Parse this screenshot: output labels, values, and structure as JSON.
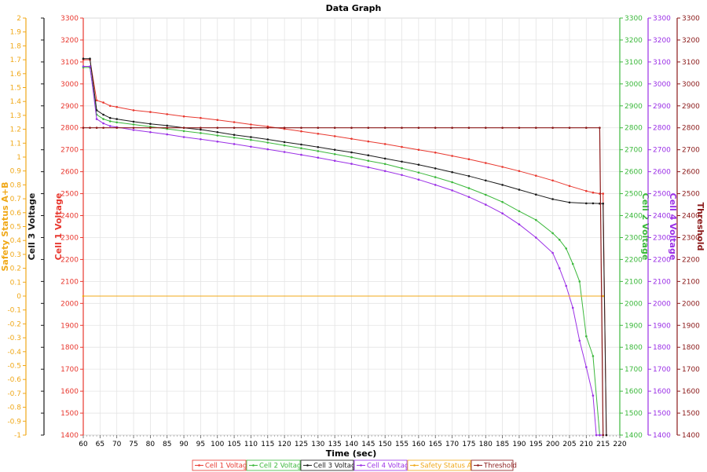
{
  "colors": {
    "cell1": "#e8382f",
    "cell2": "#3cb83c",
    "cell3": "#1a1a1a",
    "cell4": "#9b30e6",
    "safety": "#f0a818",
    "threshold": "#8b1a1a",
    "grid": "#e4e4e4"
  },
  "chart_data": {
    "type": "line",
    "title": "Data Graph",
    "xlabel": "Time (sec)",
    "xlim": [
      60,
      220
    ],
    "xticks": [
      60,
      65,
      70,
      75,
      80,
      85,
      90,
      95,
      100,
      105,
      110,
      115,
      120,
      125,
      130,
      135,
      140,
      145,
      150,
      155,
      160,
      165,
      170,
      175,
      180,
      185,
      190,
      195,
      200,
      205,
      210,
      215,
      220
    ],
    "grid": true,
    "legend_position": "bottom",
    "axes": {
      "cell1": {
        "label": "Cell 1 Voltage",
        "side": "left",
        "ylim": [
          1400,
          3300
        ],
        "ticks": [
          1400,
          1500,
          1600,
          1700,
          1800,
          1900,
          2000,
          2100,
          2200,
          2300,
          2400,
          2500,
          2600,
          2700,
          2800,
          2900,
          3000,
          3100,
          3200,
          3300
        ]
      },
      "cell3": {
        "label": "Cell 3 Voltage",
        "side": "left",
        "ylim": [
          1400,
          3300
        ],
        "ticks": [
          1400,
          1500,
          1600,
          1700,
          1800,
          1900,
          2000,
          2100,
          2200,
          2300,
          2400,
          2500,
          2600,
          2700,
          2800,
          2900,
          3000,
          3100,
          3200,
          3300
        ]
      },
      "safety": {
        "label": "Safety Status A+B",
        "side": "left",
        "ylim": [
          -1,
          2
        ],
        "ticks": [
          "-1",
          "-0.9",
          "-0.8",
          "-0.7",
          "-0.6",
          "-0.5",
          "-0.4",
          "-0.3",
          "-0.2",
          "-0.1",
          "0",
          "0.1",
          "0.2",
          "0.3",
          "0.4",
          "0.5",
          "0.6",
          "0.7",
          "0.8",
          "0.9",
          "1",
          "1.1",
          "1.2",
          "1.3",
          "1.4",
          "1.5",
          "1.6",
          "1.7",
          "1.8",
          "1.9",
          "2"
        ]
      },
      "cell2": {
        "label": "Cell 2 Voltage",
        "side": "right",
        "ylim": [
          1400,
          3300
        ],
        "ticks": [
          1400,
          1500,
          1600,
          1700,
          1800,
          1900,
          2000,
          2100,
          2200,
          2300,
          2400,
          2500,
          2600,
          2700,
          2800,
          2900,
          3000,
          3100,
          3200,
          3300
        ]
      },
      "cell4": {
        "label": "Cell 4 Voltage",
        "side": "right",
        "ylim": [
          1400,
          3300
        ],
        "ticks": [
          1400,
          1500,
          1600,
          1700,
          1800,
          1900,
          2000,
          2100,
          2200,
          2300,
          2400,
          2500,
          2600,
          2700,
          2800,
          2900,
          3000,
          3100,
          3200,
          3300
        ]
      },
      "threshold": {
        "label": "Threshold",
        "side": "right",
        "ylim": [
          1400,
          3300
        ],
        "ticks": [
          1400,
          1500,
          1600,
          1700,
          1800,
          1900,
          2000,
          2100,
          2200,
          2300,
          2400,
          2500,
          2600,
          2700,
          2800,
          2900,
          3000,
          3100,
          3200,
          3300
        ]
      }
    },
    "series": [
      {
        "name": "Cell 1 Voltage",
        "key": "cell1",
        "axis": "cell1",
        "x": [
          60,
          62,
          64,
          66,
          68,
          70,
          75,
          80,
          85,
          90,
          95,
          100,
          105,
          110,
          115,
          120,
          125,
          130,
          135,
          140,
          145,
          150,
          155,
          160,
          165,
          170,
          175,
          180,
          185,
          190,
          195,
          200,
          205,
          210,
          212,
          214,
          215,
          216
        ],
        "y": [
          3110,
          3110,
          2925,
          2915,
          2900,
          2895,
          2880,
          2872,
          2862,
          2852,
          2845,
          2836,
          2826,
          2815,
          2806,
          2795,
          2784,
          2773,
          2762,
          2750,
          2738,
          2726,
          2713,
          2700,
          2687,
          2672,
          2657,
          2640,
          2622,
          2603,
          2582,
          2560,
          2535,
          2512,
          2505,
          2500,
          2500,
          1400
        ]
      },
      {
        "name": "Cell 2 Voltage",
        "key": "cell2",
        "axis": "cell2",
        "x": [
          60,
          62,
          64,
          66,
          68,
          70,
          75,
          80,
          85,
          90,
          95,
          100,
          105,
          110,
          115,
          120,
          125,
          130,
          135,
          140,
          145,
          150,
          155,
          160,
          165,
          170,
          175,
          180,
          185,
          190,
          195,
          200,
          202,
          204,
          206,
          208,
          210,
          212,
          214,
          215
        ],
        "y": [
          3075,
          3075,
          2860,
          2840,
          2830,
          2825,
          2815,
          2805,
          2795,
          2785,
          2776,
          2765,
          2755,
          2745,
          2733,
          2720,
          2707,
          2694,
          2680,
          2666,
          2650,
          2635,
          2616,
          2596,
          2575,
          2552,
          2525,
          2495,
          2462,
          2420,
          2380,
          2320,
          2290,
          2250,
          2180,
          2100,
          1850,
          1760,
          1400,
          1400
        ]
      },
      {
        "name": "Cell 3 Voltage",
        "key": "cell3",
        "axis": "cell3",
        "x": [
          60,
          62,
          64,
          66,
          68,
          70,
          75,
          80,
          85,
          90,
          95,
          100,
          105,
          110,
          115,
          120,
          125,
          130,
          135,
          140,
          145,
          150,
          155,
          160,
          165,
          170,
          175,
          180,
          185,
          190,
          195,
          200,
          205,
          210,
          212,
          214,
          215,
          216
        ],
        "y": [
          3115,
          3115,
          2880,
          2860,
          2845,
          2840,
          2828,
          2818,
          2810,
          2800,
          2792,
          2780,
          2768,
          2758,
          2747,
          2735,
          2724,
          2712,
          2700,
          2688,
          2675,
          2660,
          2646,
          2632,
          2615,
          2598,
          2580,
          2560,
          2540,
          2518,
          2496,
          2475,
          2460,
          2456,
          2456,
          2455,
          2455,
          1400
        ]
      },
      {
        "name": "Cell 4 Voltage",
        "key": "cell4",
        "axis": "cell4",
        "x": [
          60,
          62,
          64,
          66,
          68,
          70,
          75,
          80,
          85,
          90,
          95,
          100,
          105,
          110,
          115,
          120,
          125,
          130,
          135,
          140,
          145,
          150,
          155,
          160,
          165,
          170,
          175,
          180,
          185,
          190,
          195,
          200,
          202,
          204,
          206,
          208,
          210,
          212,
          213,
          214,
          215
        ],
        "y": [
          3080,
          3080,
          2840,
          2820,
          2808,
          2803,
          2790,
          2780,
          2770,
          2758,
          2748,
          2737,
          2726,
          2714,
          2702,
          2690,
          2677,
          2664,
          2650,
          2636,
          2620,
          2603,
          2585,
          2564,
          2540,
          2515,
          2485,
          2450,
          2410,
          2360,
          2300,
          2230,
          2160,
          2080,
          1980,
          1830,
          1710,
          1580,
          1400,
          1400,
          1400
        ]
      },
      {
        "name": "Safety Status A+B",
        "key": "safety",
        "axis": "safety",
        "x": [
          60,
          215
        ],
        "y": [
          0,
          0
        ]
      },
      {
        "name": "Threshold",
        "key": "threshold",
        "axis": "threshold",
        "x": [
          60,
          62,
          64,
          66,
          70,
          75,
          80,
          85,
          90,
          95,
          100,
          105,
          110,
          115,
          120,
          125,
          130,
          135,
          140,
          145,
          150,
          155,
          160,
          165,
          170,
          175,
          180,
          185,
          190,
          195,
          200,
          205,
          210,
          214,
          215
        ],
        "y": [
          2800,
          2800,
          2800,
          2800,
          2800,
          2800,
          2800,
          2800,
          2800,
          2800,
          2800,
          2800,
          2800,
          2800,
          2800,
          2800,
          2800,
          2800,
          2800,
          2800,
          2800,
          2800,
          2800,
          2800,
          2800,
          2800,
          2800,
          2800,
          2800,
          2800,
          2800,
          2800,
          2800,
          2800,
          1400
        ]
      }
    ]
  }
}
